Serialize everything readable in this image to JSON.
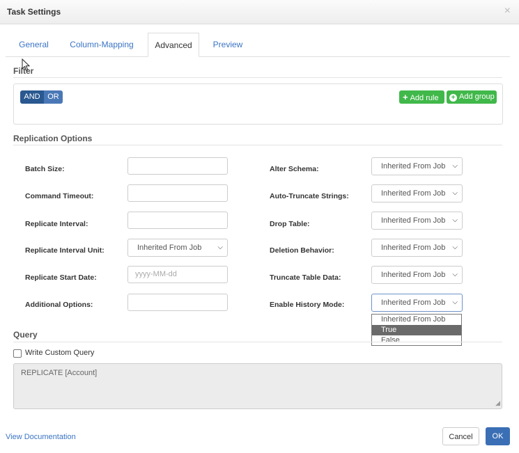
{
  "dialog": {
    "title": "Task Settings",
    "close_glyph": "×"
  },
  "tabs": [
    {
      "label": "General"
    },
    {
      "label": "Column-Mapping"
    },
    {
      "label": "Advanced",
      "active": true
    },
    {
      "label": "Preview"
    }
  ],
  "filter": {
    "section_label": "Filter",
    "and_label": "AND",
    "or_label": "OR",
    "add_rule_label": "Add rule",
    "add_group_label": "Add group"
  },
  "replication": {
    "section_label": "Replication Options",
    "left": [
      {
        "label": "Batch Size:",
        "value": ""
      },
      {
        "label": "Command Timeout:",
        "value": ""
      },
      {
        "label": "Replicate Interval:",
        "value": ""
      },
      {
        "label": "Replicate Interval Unit:",
        "value": "Inherited From Job"
      },
      {
        "label": "Replicate Start Date:",
        "placeholder": "yyyy-MM-dd"
      },
      {
        "label": "Additional Options:",
        "value": ""
      }
    ],
    "right": [
      {
        "label": "Alter Schema:",
        "value": "Inherited From Job"
      },
      {
        "label": "Auto-Truncate Strings:",
        "value": "Inherited From Job"
      },
      {
        "label": "Drop Table:",
        "value": "Inherited From Job"
      },
      {
        "label": "Deletion Behavior:",
        "value": "Inherited From Job"
      },
      {
        "label": "Truncate Table Data:",
        "value": "Inherited From Job"
      },
      {
        "label": "Enable History Mode:",
        "value": "Inherited From Job"
      }
    ],
    "history_dropdown_options": [
      "Inherited From Job",
      "True",
      "False"
    ],
    "history_dropdown_highlighted": "True"
  },
  "query": {
    "section_label": "Query",
    "custom_query_label": "Write Custom Query",
    "custom_query_checked": false,
    "text": "REPLICATE [Account]"
  },
  "footer": {
    "doc_link": "View Documentation",
    "cancel_label": "Cancel",
    "ok_label": "OK"
  },
  "colors": {
    "accent": "#3b6fb5",
    "link": "#3a74c4",
    "green": "#41b84a",
    "and_button": "#2a5890"
  },
  "icons": {
    "close": "close-icon",
    "select_chevron": "chevron-down-icon",
    "add_rule": "plus-icon",
    "add_group": "plus-circle-icon",
    "resize": "resize-grip-icon"
  }
}
